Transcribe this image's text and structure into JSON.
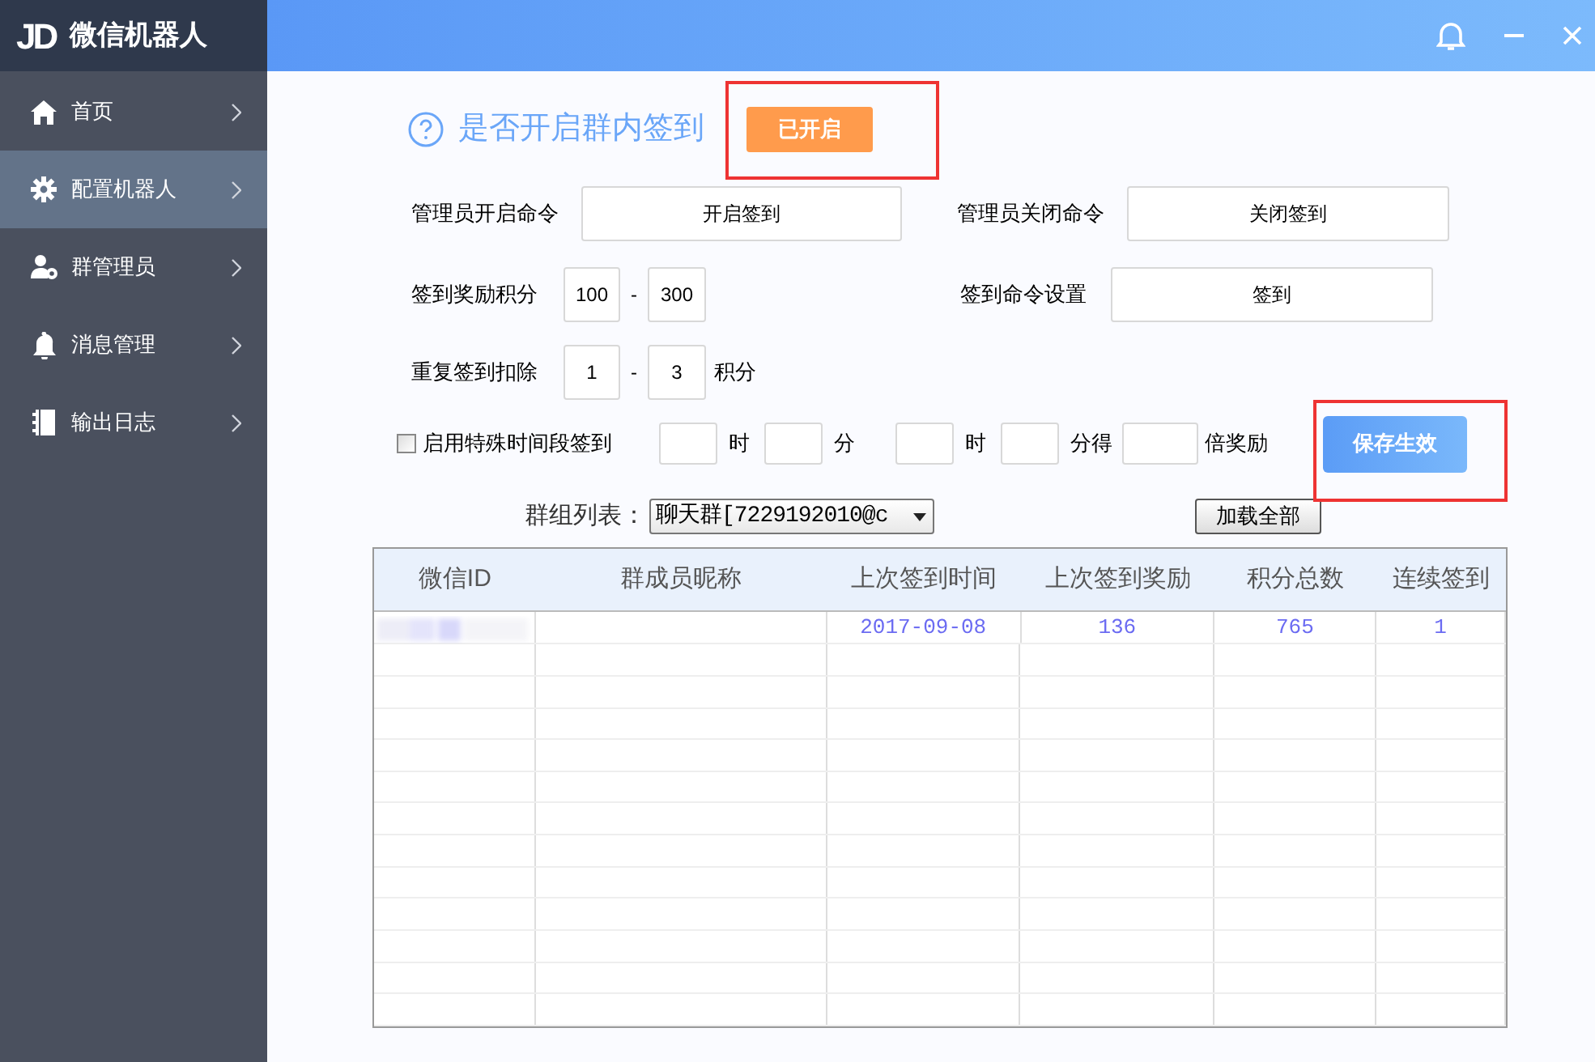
{
  "app": {
    "title": "微信机器人",
    "logo": "JD"
  },
  "sidebar": {
    "items": [
      {
        "label": "首页",
        "kind": "home",
        "selected": false
      },
      {
        "label": "配置机器人",
        "kind": "settings",
        "selected": true
      },
      {
        "label": "群管理员",
        "kind": "admins",
        "selected": false
      },
      {
        "label": "消息管理",
        "kind": "messages",
        "selected": false
      },
      {
        "label": "输出日志",
        "kind": "log",
        "selected": false
      }
    ]
  },
  "signin": {
    "title": "是否开启群内签到",
    "status_button": "已开启",
    "enabled": true,
    "admin_open_label": "管理员开启命令",
    "admin_open_value": "开启签到",
    "admin_close_label": "管理员关闭命令",
    "admin_close_value": "关闭签到",
    "reward_label": "签到奖励积分",
    "reward_min": "100",
    "reward_sep": "-",
    "reward_max": "300",
    "command_label": "签到命令设置",
    "command_value": "签到",
    "repeat_label": "重复签到扣除",
    "repeat_min": "1",
    "repeat_sep": "-",
    "repeat_max": "3",
    "repeat_unit": "积分",
    "special": {
      "label": "启用特殊时间段签到",
      "checked": false,
      "unit_hour_1": "时",
      "unit_min_1": "分",
      "unit_hour_2": "时",
      "unit_min_2": "分得",
      "unit_bonus": "倍奖励"
    },
    "save_button": "保存生效"
  },
  "group": {
    "label": "群组列表：",
    "selected": "聊天群[7229192010@c",
    "load_button": "加载全部"
  },
  "table": {
    "columns": [
      "微信ID",
      "群成员昵称",
      "上次签到时间",
      "上次签到奖励",
      "积分总数",
      "连续签到"
    ],
    "rows": [
      {
        "wxid_redacted": true,
        "last_time": "2017-09-08",
        "last_reward": "136",
        "total": "765",
        "streak": "1"
      }
    ]
  }
}
